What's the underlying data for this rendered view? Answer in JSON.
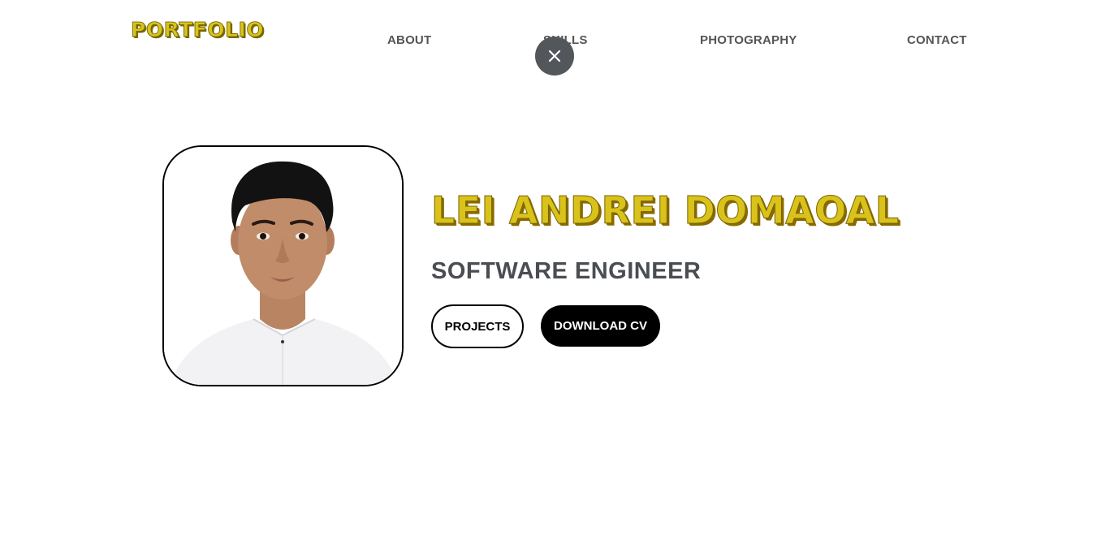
{
  "header": {
    "logo": "PORTFOLIO",
    "nav": [
      {
        "label": "ABOUT"
      },
      {
        "label": "SKILLS"
      },
      {
        "label": "PHOTOGRAPHY"
      },
      {
        "label": "CONTACT"
      }
    ]
  },
  "overlay": {
    "close_icon": "close-icon"
  },
  "profile": {
    "name": "LEI ANDREI DOMAOAL",
    "role": "SOFTWARE ENGINEER",
    "buttons": {
      "projects": "PROJECTS",
      "download_cv": "DOWNLOAD CV"
    }
  },
  "colors": {
    "accent": "#d9c31b",
    "text": "#4a4d51",
    "close_bg": "#53565a"
  }
}
